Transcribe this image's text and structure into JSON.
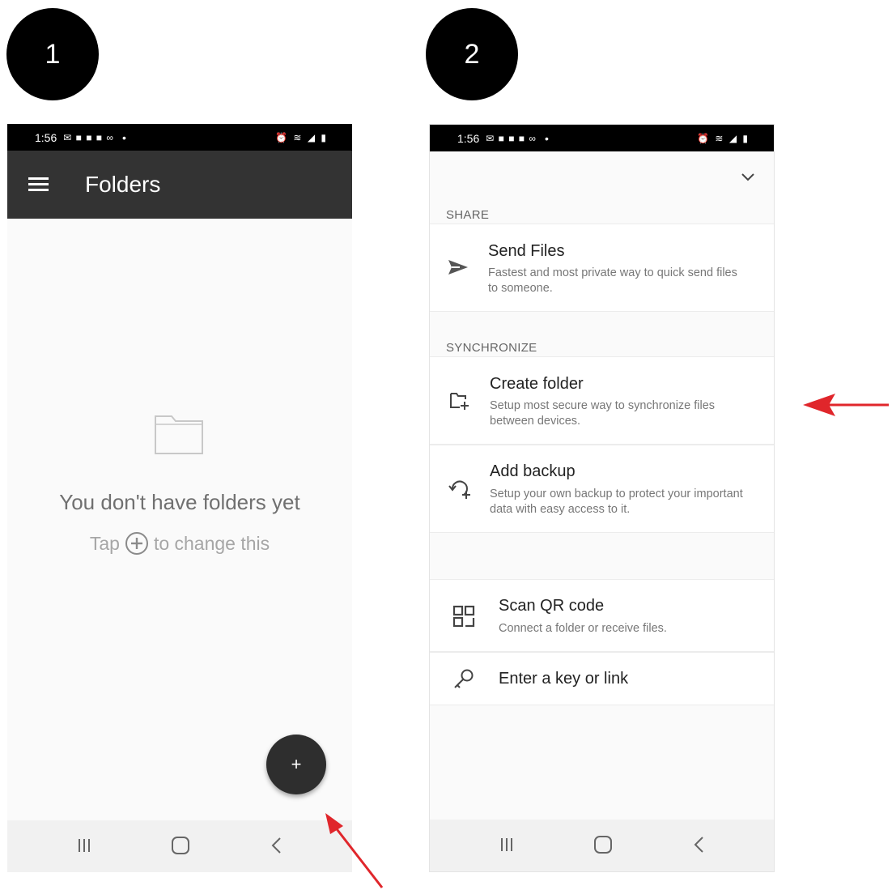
{
  "steps": [
    "1",
    "2"
  ],
  "status_bar": {
    "time": "1:56",
    "notifications": "✉ ■ ■ ■ ∞",
    "dot": "•",
    "right_icons": "⏰ ≋ ◢ ▮"
  },
  "screen1": {
    "app_title": "Folders",
    "empty_title": "You don't have folders yet",
    "hint_before": "Tap",
    "hint_after": "to change this",
    "fab_label": "+"
  },
  "screen2": {
    "share_label": "SHARE",
    "send_files": {
      "title": "Send Files",
      "description": "Fastest and most private way to quick send files to someone."
    },
    "sync_label": "SYNCHRONIZE",
    "create_folder": {
      "title": "Create folder",
      "description": "Setup most secure way to synchronize files between devices."
    },
    "add_backup": {
      "title": "Add backup",
      "description": "Setup your own backup to protect your important data with easy access to it."
    },
    "scan_qr": {
      "title": "Scan QR code",
      "description": "Connect a folder or receive files."
    },
    "enter_key": {
      "title": "Enter a key or link"
    }
  },
  "colors": {
    "app_bar": "#333333",
    "arrow": "#e0262b",
    "fab": "#2e2e2e"
  },
  "icons": [
    "menu-icon",
    "folder-icon",
    "add-circle-icon",
    "plus-icon",
    "recents-icon",
    "home-icon",
    "back-icon",
    "chevron-down-icon",
    "send-icon",
    "create-folder-icon",
    "backup-icon",
    "qr-code-icon",
    "key-icon"
  ]
}
